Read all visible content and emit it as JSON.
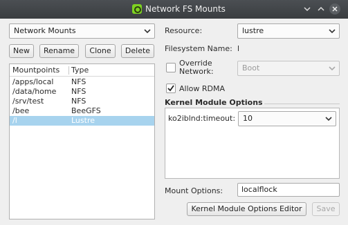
{
  "window": {
    "title": "Network FS Mounts",
    "buttons": [
      "minimize",
      "maximize",
      "close"
    ]
  },
  "left": {
    "view_select": "Network Mounts",
    "buttons": {
      "new": "New",
      "rename": "Rename",
      "clone": "Clone",
      "delete": "Delete"
    },
    "table": {
      "headers": [
        "Mountpoints",
        "Type"
      ],
      "rows": [
        {
          "mount": "/apps/local",
          "type": "NFS"
        },
        {
          "mount": "/data/home",
          "type": "NFS"
        },
        {
          "mount": "/srv/test",
          "type": "NFS"
        },
        {
          "mount": "/bee",
          "type": "BeeGFS"
        },
        {
          "mount": "/l",
          "type": "Lustre",
          "selected": true
        }
      ]
    }
  },
  "right": {
    "resource_label": "Resource:",
    "resource_value": "lustre",
    "fs_name_label": "Filesystem Name:",
    "fs_name_value": "l",
    "override_label_1": "Override",
    "override_label_2": "Network:",
    "override_checked": false,
    "network_value": "Boot",
    "rdma_label": "Allow RDMA",
    "rdma_checked": true,
    "kmod_section_title": "Kernel Module Options",
    "kmod_option_label": "ko2iblnd:timeout:",
    "kmod_option_value": "10",
    "mount_options_label": "Mount Options:",
    "mount_options_value": "localflock",
    "kmod_editor_button": "Kernel Module Options Editor",
    "save_button": "Save"
  },
  "colors": {
    "titlebar": "#3f4245",
    "selection": "#a7d3ee",
    "app_icon": "#7ed321"
  }
}
